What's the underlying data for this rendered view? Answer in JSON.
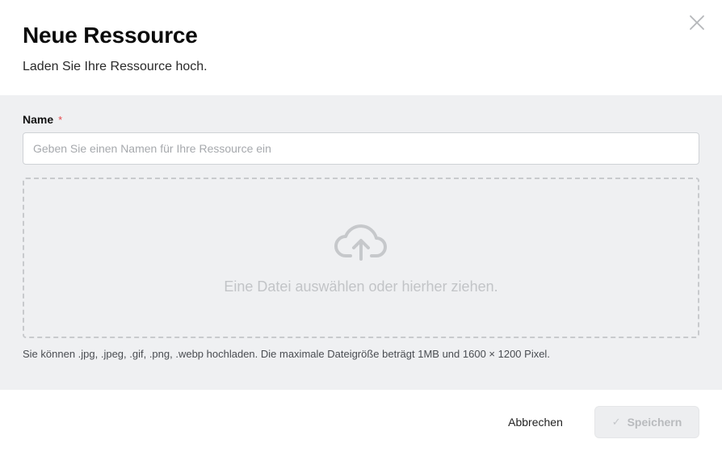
{
  "dialog": {
    "title": "Neue Ressource",
    "subtitle": "Laden Sie Ihre Ressource hoch.",
    "close_icon": "close-icon"
  },
  "form": {
    "name_label": "Name",
    "required_mark": "*",
    "name_placeholder": "Geben Sie einen Namen für Ihre Ressource ein",
    "name_value": "",
    "dropzone_icon": "cloud-upload-icon",
    "dropzone_text": "Eine Datei auswählen oder hierher ziehen.",
    "hint": "Sie können .jpg, .jpeg, .gif, .png, .webp hochladen. Die maximale Dateigröße beträgt 1MB und 1600 × 1200 Pixel."
  },
  "footer": {
    "cancel_label": "Abbrechen",
    "save_label": "Speichern",
    "save_icon": "check-icon",
    "save_disabled": true
  },
  "colors": {
    "body_bg": "#eff0f2",
    "required": "#e5484d",
    "disabled_text": "#b9bbbe"
  }
}
